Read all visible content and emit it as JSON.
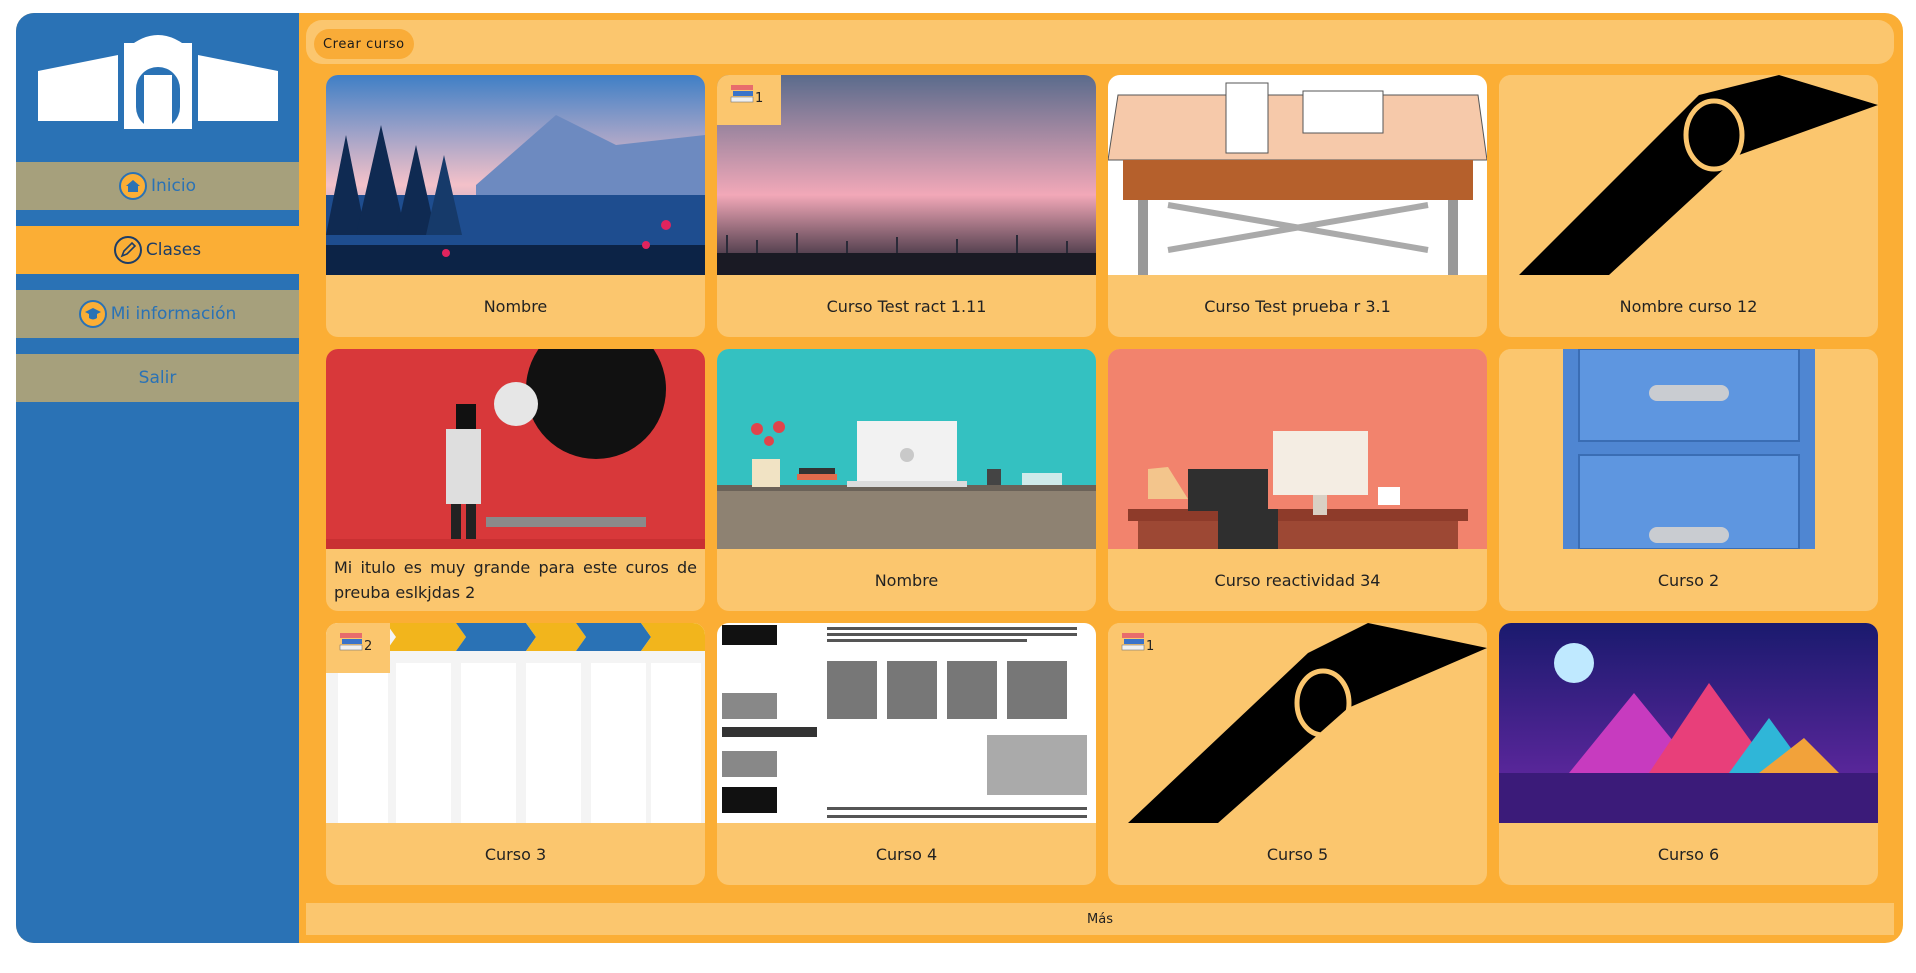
{
  "sidebar": {
    "items": [
      {
        "label": "Inicio",
        "icon": "home-icon"
      },
      {
        "label": "Clases",
        "icon": "pencil-icon"
      },
      {
        "label": "Mi información",
        "icon": "graduation-cap-icon"
      },
      {
        "label": "Salir"
      }
    ]
  },
  "toolbar": {
    "create_label": "Crear curso"
  },
  "courses": [
    {
      "title": "Nombre",
      "badge": ""
    },
    {
      "title": "Curso Test ract 1.11",
      "badge": "1"
    },
    {
      "title": "Curso Test prueba r 3.1",
      "badge": ""
    },
    {
      "title": "Nombre curso 12",
      "badge": ""
    },
    {
      "title": "Mi itulo es muy grande para este curos de preuba eslkjdas 2",
      "badge": ""
    },
    {
      "title": "Nombre",
      "badge": ""
    },
    {
      "title": "Curso reactividad 34",
      "badge": ""
    },
    {
      "title": "Curso 2",
      "badge": ""
    },
    {
      "title": "Curso 3",
      "badge": "2"
    },
    {
      "title": "Curso 4",
      "badge": ""
    },
    {
      "title": "Curso 5",
      "badge": "1"
    },
    {
      "title": "Curso 6",
      "badge": ""
    }
  ],
  "footer": {
    "more_label": "Más"
  },
  "colors": {
    "sidebar": "#2a72b5",
    "accent": "#fbae35",
    "card": "#fbc66e",
    "muted": "#a6a07c"
  }
}
